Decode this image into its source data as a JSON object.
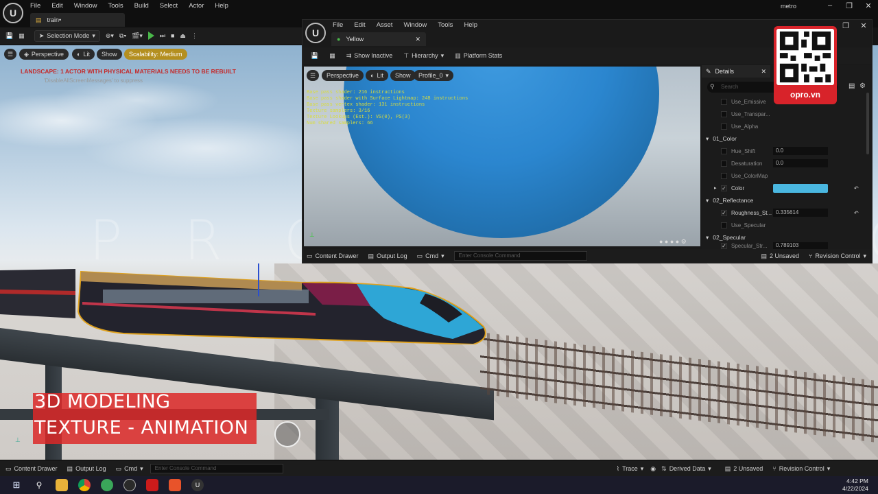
{
  "main_window": {
    "menu": [
      "File",
      "Edit",
      "Window",
      "Tools",
      "Build",
      "Select",
      "Actor",
      "Help"
    ],
    "tab_title": "train•",
    "project_name": "metro",
    "toolbar": {
      "selection_mode": "Selection Mode"
    }
  },
  "viewport": {
    "chips": {
      "perspective": "Perspective",
      "lit": "Lit",
      "show": "Show",
      "scalability": "Scalability: Medium"
    },
    "warning": "LANDSCAPE: 1 ACTOR WITH PHYSICAL MATERIALS NEEDS TO BE REBUILT",
    "warning_sub": "'DisableAllScreenMessages' to suppress",
    "watermark": "PRODUCTION",
    "overlay_line1": "3D MODELING",
    "overlay_line2": "TEXTURE - ANIMATION"
  },
  "material_editor": {
    "menu": [
      "File",
      "Edit",
      "Asset",
      "Window",
      "Tools",
      "Help"
    ],
    "tab_title": "Yellow",
    "toolbar": {
      "show_inactive": "Show Inactive",
      "hierarchy": "Hierarchy",
      "platform_stats": "Platform Stats"
    },
    "viewport_chips": {
      "perspective": "Perspective",
      "lit": "Lit",
      "show": "Show",
      "profile": "Profile_0"
    },
    "stats": [
      "Base pass shader: 216 instructions",
      "Base pass shader with Surface Lightmap: 248 instructions",
      "Base pass vertex shader: 131 instructions",
      "Texture samplers: 3/16",
      "Texture Lookups (Est.): VS(0), PS(3)",
      "Num shared samplers: 66"
    ],
    "bottom": {
      "content_drawer": "Content Drawer",
      "output_log": "Output Log",
      "cmd": "Cmd",
      "console_placeholder": "Enter Console Command",
      "unsaved": "2 Unsaved",
      "revision_control": "Revision Control"
    }
  },
  "details": {
    "title": "Details",
    "search_placeholder": "Search",
    "rows": {
      "use_emissive": "Use_Emissive",
      "use_transparency": "Use_Transpar...",
      "use_alpha": "Use_Alpha",
      "section_color": "01_Color",
      "hue_shift": "Hue_Shift",
      "hue_shift_val": "0.0",
      "desaturation": "Desaturation",
      "desaturation_val": "0.0",
      "use_colormap": "Use_ColorMap",
      "color": "Color",
      "section_reflectance": "02_Reflectance",
      "roughness": "Roughness_St...",
      "roughness_val": "0.335614",
      "use_specular": "Use_Specular",
      "section_specular": "02_Specular",
      "specular_row": "Specular_Str...",
      "specular_val": "0.789103"
    },
    "color_value": "#4ab7e0"
  },
  "qr_badge": {
    "label": "opro.vn"
  },
  "statusbar": {
    "content_drawer": "Content Drawer",
    "output_log": "Output Log",
    "cmd": "Cmd",
    "console_placeholder": "Enter Console Command",
    "trace": "Trace",
    "derived_data": "Derived Data",
    "unsaved": "2 Unsaved",
    "revision_control": "Revision Control"
  },
  "taskbar": {
    "time": "4:42 PM",
    "date": "4/22/2024"
  }
}
